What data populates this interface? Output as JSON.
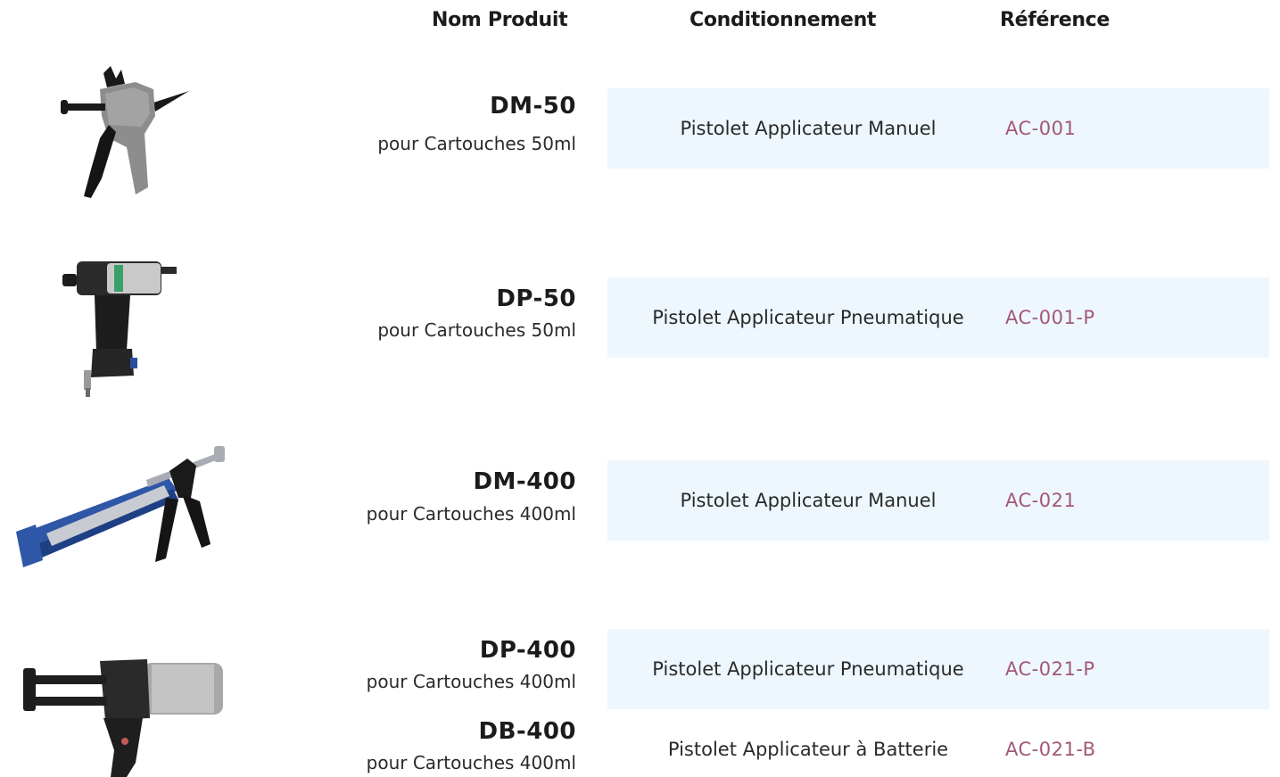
{
  "headers": {
    "product": "Nom Produit",
    "packaging": "Conditionnement",
    "reference": "Référence"
  },
  "colors": {
    "reference_text": "#a25878",
    "band_background": "#eef7fd",
    "heading_text": "#1b1b1b"
  },
  "products": [
    {
      "name": "DM-50",
      "subtitle": "pour Cartouches 50ml",
      "packaging": "Pistolet Applicateur Manuel",
      "reference": "AC-001",
      "image": "manual-gun-50ml"
    },
    {
      "name": "DP-50",
      "subtitle": "pour Cartouches 50ml",
      "packaging": "Pistolet Applicateur Pneumatique",
      "reference": "AC-001-P",
      "image": "pneumatic-gun-50ml"
    },
    {
      "name": "DM-400",
      "subtitle": "pour Cartouches 400ml",
      "packaging": "Pistolet Applicateur Manuel",
      "reference": "AC-021",
      "image": "manual-gun-400ml"
    },
    {
      "name": "DP-400",
      "subtitle": "pour Cartouches 400ml",
      "packaging": "Pistolet Applicateur Pneumatique",
      "reference": "AC-021-P",
      "image": "pneumatic-gun-400ml"
    },
    {
      "name": "DB-400",
      "subtitle": "pour Cartouches 400ml",
      "packaging": "Pistolet Applicateur à Batterie",
      "reference": "AC-021-B",
      "image": "battery-gun-400ml"
    }
  ]
}
